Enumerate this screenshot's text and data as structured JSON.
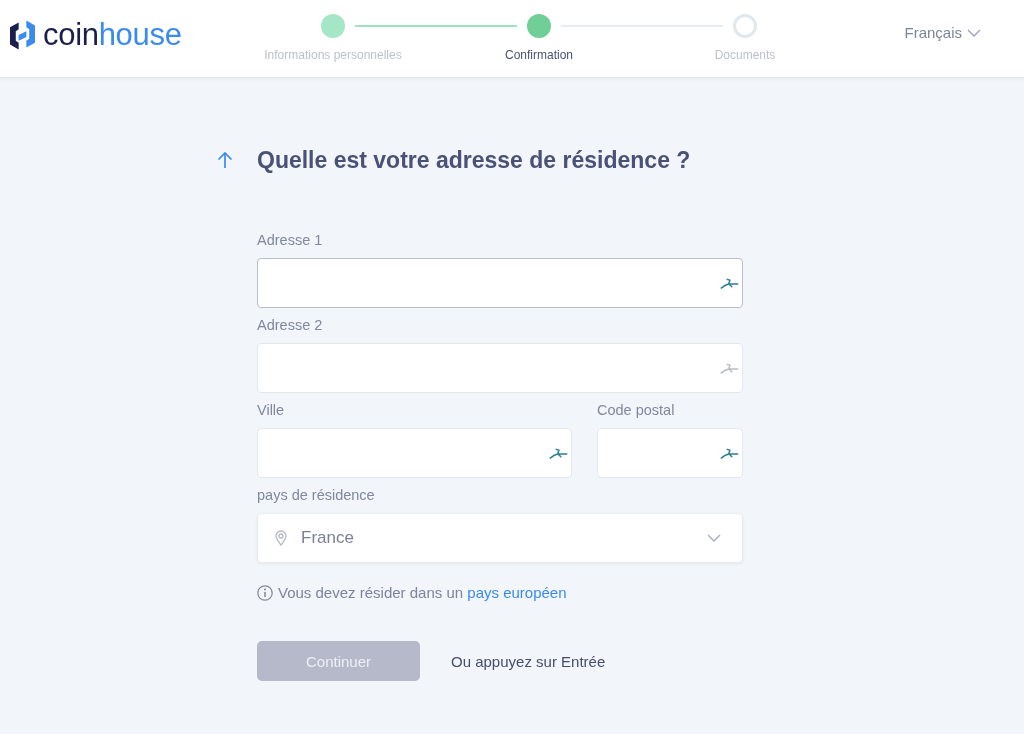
{
  "header": {
    "logo": {
      "parts": [
        "coin",
        "house"
      ]
    },
    "steps": [
      {
        "label": "Informations personnelles",
        "completed": true,
        "selected": false
      },
      {
        "label": "Confirmation",
        "completed": false,
        "selected": true
      },
      {
        "label": "Documents",
        "completed": false,
        "selected": false
      }
    ],
    "language": {
      "label": "Français"
    }
  },
  "form": {
    "title": "Quelle est votre adresse de résidence ?",
    "field_rows": [
      {
        "fields": [
          {
            "label": "Adresse 1",
            "focused": true,
            "autofill_active": true
          }
        ]
      },
      {
        "fields": [
          {
            "label": "Adresse 2",
            "focused": false,
            "autofill_active": false
          }
        ]
      },
      {
        "fields": [
          {
            "label": "Ville",
            "focused": false,
            "autofill_active": true
          },
          {
            "label": "Code postal",
            "focused": false,
            "autofill_active": true
          }
        ]
      }
    ],
    "country_select": {
      "label": "pays de résidence",
      "value": "France"
    },
    "notice": {
      "text": "Vous devez résider dans un",
      "link": "pays européen"
    },
    "submit": {
      "label": "Continuer",
      "disabled": true
    },
    "hint": "Ou appuyez sur Entrée"
  }
}
